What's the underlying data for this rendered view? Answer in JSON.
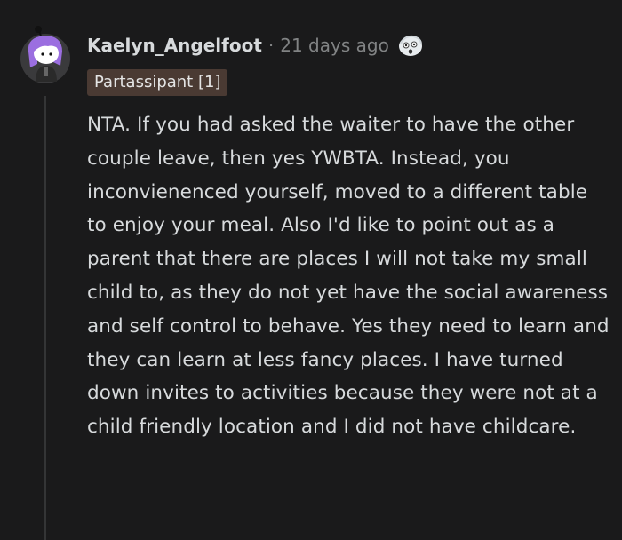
{
  "comment": {
    "author": {
      "username": "Kaelyn_Angelfoot",
      "avatar_icon": "snoo-avatar-purple-hair"
    },
    "separator": "·",
    "timestamp": "21 days ago",
    "award_icon": "surprised-face-award-icon",
    "flair": "Partassipant [1]",
    "body": "NTA. If you had asked the waiter to have the other couple leave, then yes YWBTA. Instead, you inconvienenced yourself, moved to a different table to enjoy your meal. Also I'd like to point out as a parent that there are places I will not take my small child to, as they do not yet have the social awareness and self control to behave. Yes they need to learn and they can learn at less fancy places. I have turned down invites to activities because they were not at a child friendly location and I did not have childcare."
  },
  "colors": {
    "background": "#1a1a1b",
    "text": "#d7dadc",
    "muted": "#818384",
    "flair_bg": "#4a3a33",
    "avatar_hair": "#9b6ee0"
  }
}
